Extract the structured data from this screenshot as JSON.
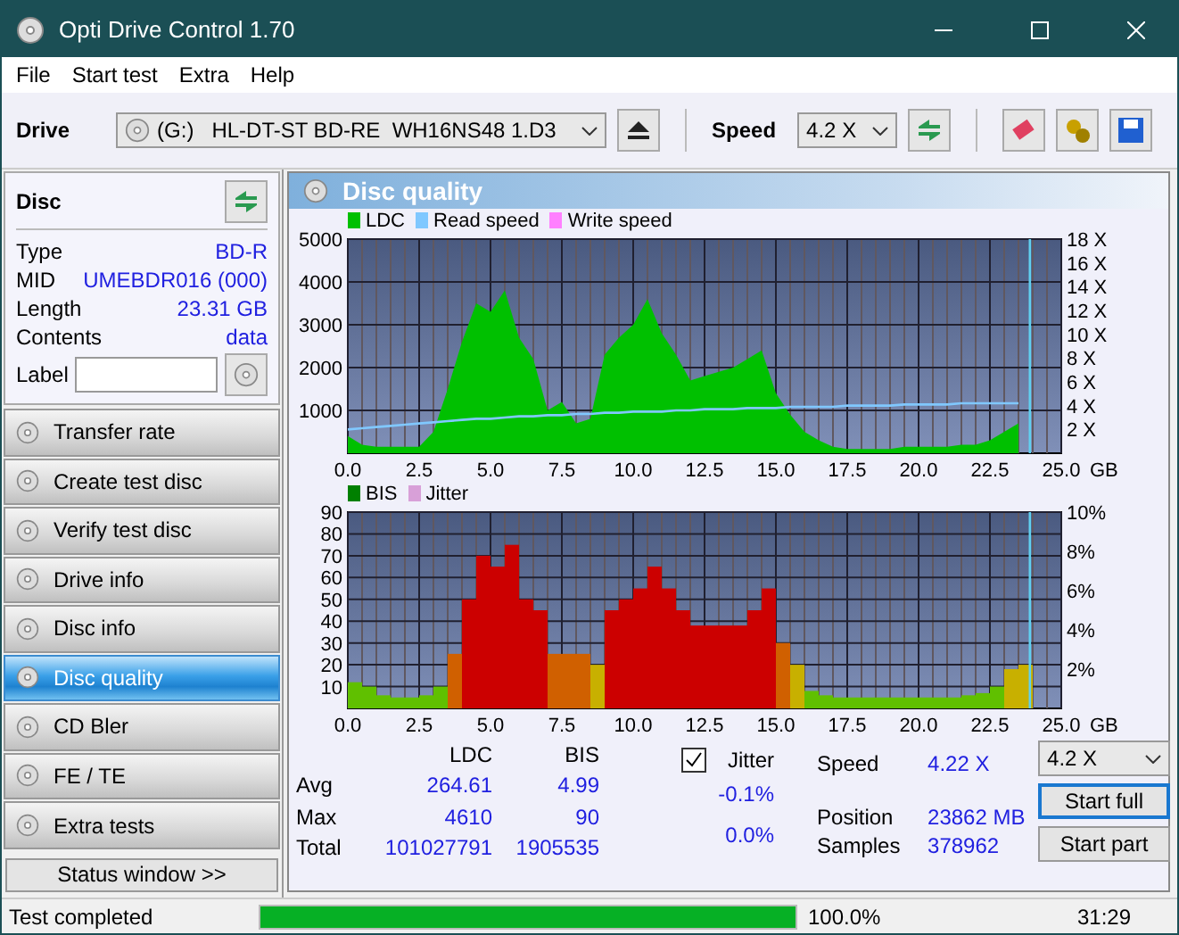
{
  "window": {
    "title": "Opti Drive Control 1.70"
  },
  "menu": [
    "File",
    "Start test",
    "Extra",
    "Help"
  ],
  "toolbar": {
    "drive_label": "Drive",
    "drive": "(G:)   HL-DT-ST BD-RE  WH16NS48 1.D3",
    "speed_label": "Speed",
    "speed": "4.2 X"
  },
  "disc": {
    "title": "Disc",
    "fields": [
      {
        "label": "Type",
        "value": "BD-R"
      },
      {
        "label": "MID",
        "value": "UMEBDR016 (000)"
      },
      {
        "label": "Length",
        "value": "23.31 GB"
      },
      {
        "label": "Contents",
        "value": "data"
      }
    ],
    "label_caption": "Label"
  },
  "nav": [
    {
      "label": "Transfer rate",
      "selected": false
    },
    {
      "label": "Create test disc",
      "selected": false
    },
    {
      "label": "Verify test disc",
      "selected": false
    },
    {
      "label": "Drive info",
      "selected": false
    },
    {
      "label": "Disc info",
      "selected": false
    },
    {
      "label": "Disc quality",
      "selected": true
    },
    {
      "label": "CD Bler",
      "selected": false
    },
    {
      "label": "FE / TE",
      "selected": false
    },
    {
      "label": "Extra tests",
      "selected": false
    }
  ],
  "status_window_button": "Status window >>",
  "panel": {
    "title": "Disc quality",
    "charts": [
      {
        "chart_data": {
          "type": "area",
          "xlabel": "GB",
          "x": [
            0,
            0.5,
            1,
            1.5,
            2,
            2.5,
            3,
            3.5,
            4,
            4.5,
            5,
            5.5,
            6,
            6.5,
            7,
            7.5,
            8,
            8.5,
            9,
            9.5,
            10,
            10.5,
            11,
            11.5,
            12,
            12.5,
            13,
            13.5,
            14,
            14.5,
            15,
            15.5,
            16,
            16.5,
            17,
            17.5,
            18,
            18.5,
            19,
            19.5,
            20,
            20.5,
            21,
            21.5,
            22,
            22.5,
            23,
            23.5
          ],
          "series": [
            {
              "name": "LDC",
              "color": "#00c000",
              "values": [
                400,
                200,
                150,
                150,
                150,
                150,
                500,
                1500,
                2600,
                3500,
                3300,
                3800,
                2700,
                2200,
                1000,
                1200,
                700,
                800,
                2300,
                2700,
                3000,
                3600,
                2800,
                2300,
                1700,
                1800,
                1900,
                2000,
                2200,
                2400,
                1400,
                900,
                500,
                300,
                150,
                100,
                100,
                100,
                100,
                150,
                150,
                150,
                150,
                200,
                200,
                300,
                500,
                700
              ]
            },
            {
              "name": "Read speed",
              "color": "#80c8ff",
              "axis": "y2",
              "type": "line",
              "values": [
                2.0,
                2.1,
                2.2,
                2.3,
                2.4,
                2.5,
                2.6,
                2.7,
                2.8,
                2.9,
                2.9,
                3.0,
                3.1,
                3.1,
                3.2,
                3.2,
                3.3,
                3.3,
                3.4,
                3.4,
                3.5,
                3.5,
                3.5,
                3.6,
                3.6,
                3.7,
                3.7,
                3.7,
                3.8,
                3.8,
                3.8,
                3.9,
                3.9,
                3.9,
                3.9,
                4.0,
                4.0,
                4.0,
                4.0,
                4.1,
                4.1,
                4.1,
                4.1,
                4.2,
                4.2,
                4.2,
                4.2,
                4.2
              ]
            },
            {
              "name": "Write speed",
              "color": "#ff80ff",
              "values": [
                null,
                null,
                null,
                null,
                null,
                null,
                null,
                null,
                null,
                null,
                null,
                null,
                null,
                null,
                null,
                null,
                null,
                null,
                null,
                null,
                null,
                null,
                null,
                null,
                null,
                null,
                null,
                null,
                null,
                null,
                null,
                null,
                null,
                null,
                null,
                null,
                null,
                null,
                null,
                null,
                null,
                null,
                null,
                null,
                null,
                null,
                null,
                null
              ]
            }
          ],
          "xlim": [
            0,
            25
          ],
          "ylim": [
            0,
            5000
          ],
          "y2lim": [
            0,
            18
          ],
          "grid": true,
          "ref_lines": [
            {
              "axis": "x",
              "value": 23.9,
              "color": "#60d0f0"
            }
          ],
          "xticks": [
            {
              "value": 0,
              "label": "0.0"
            },
            {
              "value": 2.5,
              "label": "2.5"
            },
            {
              "value": 5,
              "label": "5.0"
            },
            {
              "value": 7.5,
              "label": "7.5"
            },
            {
              "value": 10,
              "label": "10.0"
            },
            {
              "value": 12.5,
              "label": "12.5"
            },
            {
              "value": 15,
              "label": "15.0"
            },
            {
              "value": 17.5,
              "label": "17.5"
            },
            {
              "value": 20,
              "label": "20.0"
            },
            {
              "value": 22.5,
              "label": "22.5"
            },
            {
              "value": 25,
              "label": "25.0"
            }
          ],
          "yticks": [
            1000,
            2000,
            3000,
            4000,
            5000
          ],
          "y2ticks": [
            {
              "value": 2,
              "label": "2 X"
            },
            {
              "value": 4,
              "label": "4 X"
            },
            {
              "value": 6,
              "label": "6 X"
            },
            {
              "value": 8,
              "label": "8 X"
            },
            {
              "value": 10,
              "label": "10 X"
            },
            {
              "value": 12,
              "label": "12 X"
            },
            {
              "value": 14,
              "label": "14 X"
            },
            {
              "value": 16,
              "label": "16 X"
            },
            {
              "value": 18,
              "label": "18 X"
            }
          ]
        }
      },
      {
        "chart_data": {
          "type": "bar",
          "xlabel": "GB",
          "x": [
            0,
            0.5,
            1,
            1.5,
            2,
            2.5,
            3,
            3.5,
            4,
            4.5,
            5,
            5.5,
            6,
            6.5,
            7,
            7.5,
            8,
            8.5,
            9,
            9.5,
            10,
            10.5,
            11,
            11.5,
            12,
            12.5,
            13,
            13.5,
            14,
            14.5,
            15,
            15.5,
            16,
            16.5,
            17,
            17.5,
            18,
            18.5,
            19,
            19.5,
            20,
            20.5,
            21,
            21.5,
            22,
            22.5,
            23,
            23.5
          ],
          "series": [
            {
              "name": "BIS",
              "color": "#008000",
              "colors": [
                "#60c000",
                "#60c000",
                "#60c000",
                "#60c000",
                "#60c000",
                "#60c000",
                "#60c000",
                "#d06000",
                "#cc0000",
                "#cc0000",
                "#cc0000",
                "#cc0000",
                "#cc0000",
                "#cc0000",
                "#d06000",
                "#d06000",
                "#d06000",
                "#c8b000",
                "#cc0000",
                "#cc0000",
                "#cc0000",
                "#cc0000",
                "#cc0000",
                "#cc0000",
                "#cc0000",
                "#cc0000",
                "#cc0000",
                "#cc0000",
                "#cc0000",
                "#cc0000",
                "#d06000",
                "#c8b000",
                "#60c000",
                "#60c000",
                "#60c000",
                "#60c000",
                "#60c000",
                "#60c000",
                "#60c000",
                "#60c000",
                "#60c000",
                "#60c000",
                "#60c000",
                "#60c000",
                "#60c000",
                "#60c000",
                "#c8b000",
                "#c8b000"
              ],
              "values": [
                12,
                10,
                6,
                5,
                5,
                6,
                10,
                25,
                50,
                70,
                65,
                75,
                50,
                45,
                25,
                25,
                25,
                20,
                45,
                50,
                55,
                65,
                55,
                45,
                38,
                38,
                38,
                38,
                45,
                55,
                30,
                20,
                8,
                6,
                5,
                5,
                5,
                5,
                5,
                5,
                5,
                5,
                5,
                6,
                7,
                10,
                18,
                20
              ]
            },
            {
              "name": "Jitter",
              "color": "#d8a0d8",
              "values": [
                null,
                null,
                null,
                null,
                null,
                null,
                null,
                null,
                null,
                null,
                null,
                null,
                null,
                null,
                null,
                null,
                null,
                null,
                null,
                null,
                null,
                null,
                null,
                null,
                null,
                null,
                null,
                null,
                null,
                null,
                null,
                null,
                null,
                null,
                null,
                null,
                null,
                null,
                null,
                null,
                null,
                null,
                null,
                null,
                null,
                null,
                null,
                null
              ]
            }
          ],
          "xlim": [
            0,
            25
          ],
          "ylim": [
            0,
            90
          ],
          "y2lim": [
            0,
            10
          ],
          "grid": true,
          "ref_lines": [
            {
              "axis": "x",
              "value": 23.9,
              "color": "#60d0f0"
            }
          ],
          "xticks": [
            {
              "value": 0,
              "label": "0.0"
            },
            {
              "value": 2.5,
              "label": "2.5"
            },
            {
              "value": 5,
              "label": "5.0"
            },
            {
              "value": 7.5,
              "label": "7.5"
            },
            {
              "value": 10,
              "label": "10.0"
            },
            {
              "value": 12.5,
              "label": "12.5"
            },
            {
              "value": 15,
              "label": "15.0"
            },
            {
              "value": 17.5,
              "label": "17.5"
            },
            {
              "value": 20,
              "label": "20.0"
            },
            {
              "value": 22.5,
              "label": "22.5"
            },
            {
              "value": 25,
              "label": "25.0"
            }
          ],
          "yticks": [
            10,
            20,
            30,
            40,
            50,
            60,
            70,
            80,
            90
          ],
          "y2ticks": [
            {
              "value": 2,
              "label": "2%"
            },
            {
              "value": 4,
              "label": "4%"
            },
            {
              "value": 6,
              "label": "6%"
            },
            {
              "value": 8,
              "label": "8%"
            },
            {
              "value": 10,
              "label": "10%"
            }
          ]
        }
      }
    ],
    "stats": {
      "columns": [
        "LDC",
        "BIS"
      ],
      "rows": [
        {
          "label": "Avg",
          "values": [
            "264.61",
            "4.99"
          ]
        },
        {
          "label": "Max",
          "values": [
            "4610",
            "90"
          ]
        },
        {
          "label": "Total",
          "values": [
            "101027791",
            "1905535"
          ]
        }
      ],
      "jitter": {
        "label": "Jitter",
        "checked": true,
        "values": [
          "-0.1%",
          "0.0%"
        ]
      },
      "info": [
        {
          "label": "Speed",
          "value": "4.22 X"
        },
        {
          "label": "Position",
          "value": "23862 MB"
        },
        {
          "label": "Samples",
          "value": "378962"
        }
      ],
      "speed_select": "4.2 X",
      "buttons": [
        {
          "label": "Start full",
          "selected": true
        },
        {
          "label": "Start part",
          "selected": false
        }
      ]
    }
  },
  "status_bar": {
    "text": "Test completed",
    "level": 1.0,
    "percent": "100.0%",
    "time": "31:29"
  }
}
